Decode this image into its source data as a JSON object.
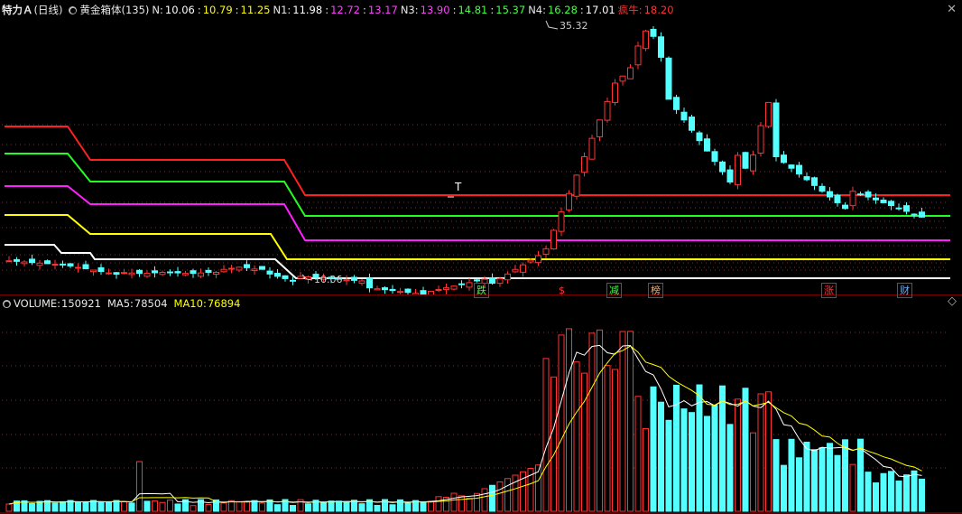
{
  "header": {
    "stock_name": "特力Ａ",
    "period": "(日线)",
    "indicator_name": "黄金箱体",
    "indicator_param": "(135)",
    "values": [
      {
        "label": "N:",
        "value": "10.06",
        "color": "#ffffff"
      },
      {
        "label": ":",
        "value": "10.79",
        "color": "#ffff00"
      },
      {
        "label": ":",
        "value": "11.25",
        "color": "#ffff00"
      },
      {
        "label": "N1:",
        "value": "11.98",
        "color": "#ffffff"
      },
      {
        "label": ":",
        "value": "12.72",
        "color": "#ff44ff"
      },
      {
        "label": ":",
        "value": "13.17",
        "color": "#ff44ff"
      },
      {
        "label": "N3:",
        "value": "13.90",
        "color": "#ff44ff"
      },
      {
        "label": ":",
        "value": "14.81",
        "color": "#44ff44"
      },
      {
        "label": ":",
        "value": "15.37",
        "color": "#44ff44"
      },
      {
        "label": "N4:",
        "value": "16.28",
        "color": "#44ff44"
      },
      {
        "label": ":",
        "value": "17.01",
        "color": "#ffffff"
      },
      {
        "label": "疯牛:",
        "value": "18.20",
        "color": "#ff3333"
      }
    ]
  },
  "volume_header": {
    "volume_label": "VOLUME:",
    "volume_value": "150921",
    "ma5_label": "MA5:",
    "ma5_value": "78504",
    "ma10_label": "MA10:",
    "ma10_value": "76894"
  },
  "annotations": {
    "high_price": "35.32",
    "low_price": "10.06",
    "t_marker": "T"
  },
  "signals": [
    {
      "label": "跌",
      "color": "#44ff44"
    },
    {
      "label": "$",
      "color": "#ff3333"
    },
    {
      "label": "减",
      "color": "#44ff44"
    },
    {
      "label": "榜",
      "color": "#ffaa66"
    },
    {
      "label": "涨",
      "color": "#ff3333"
    },
    {
      "label": "财",
      "color": "#66aaff"
    }
  ],
  "colors": {
    "up": "#ff3333",
    "down": "#54ffff",
    "ma5": "#ffffff",
    "ma10": "#ffff00",
    "line_red": "#ff2020",
    "line_green": "#20ff20",
    "line_magenta": "#ff20ff",
    "line_yellow": "#ffff00",
    "line_white": "#ffffff"
  }
}
